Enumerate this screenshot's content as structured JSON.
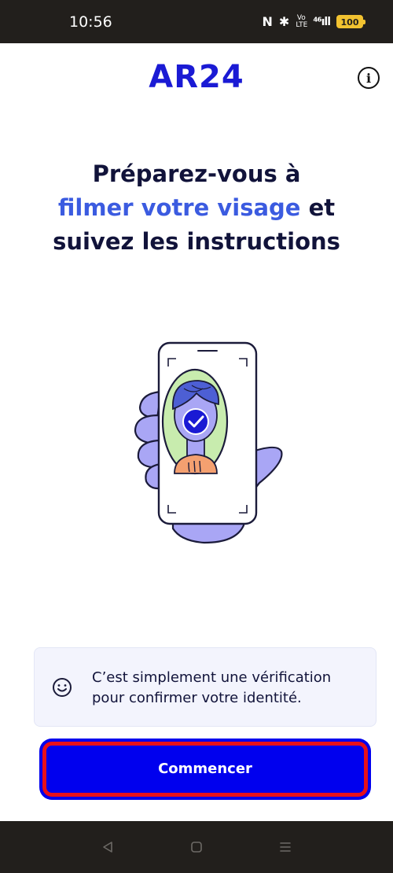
{
  "status_bar": {
    "time": "10:56",
    "nfc_icon": "nfc-icon",
    "bluetooth_icon": "bluetooth-icon",
    "volte_label": "Vo LTE",
    "signal_label": "⁴⁶ıll",
    "battery_level": "100"
  },
  "header": {
    "logo_text": "AR24",
    "info_icon": "info-icon"
  },
  "headline": {
    "line1": "Préparez-vous à",
    "highlight": "filmer votre visage",
    "connector": " et",
    "line3": "suivez les instructions"
  },
  "illustration": {
    "name": "hand-holding-phone-face-scan-illustration"
  },
  "info_card": {
    "icon": "smile-icon",
    "text": "C’est simplement une vérification pour confirmer votre identité."
  },
  "cta": {
    "label": "Commencer"
  },
  "nav_bar": {
    "back_icon": "back-triangle-icon",
    "home_icon": "home-square-icon",
    "menu_icon": "menu-lines-icon"
  },
  "colors": {
    "brand_blue": "#1a1ad4",
    "highlight_blue": "#3b5be0",
    "button_blue": "#0000ee",
    "highlight_border": "#e8101a"
  }
}
